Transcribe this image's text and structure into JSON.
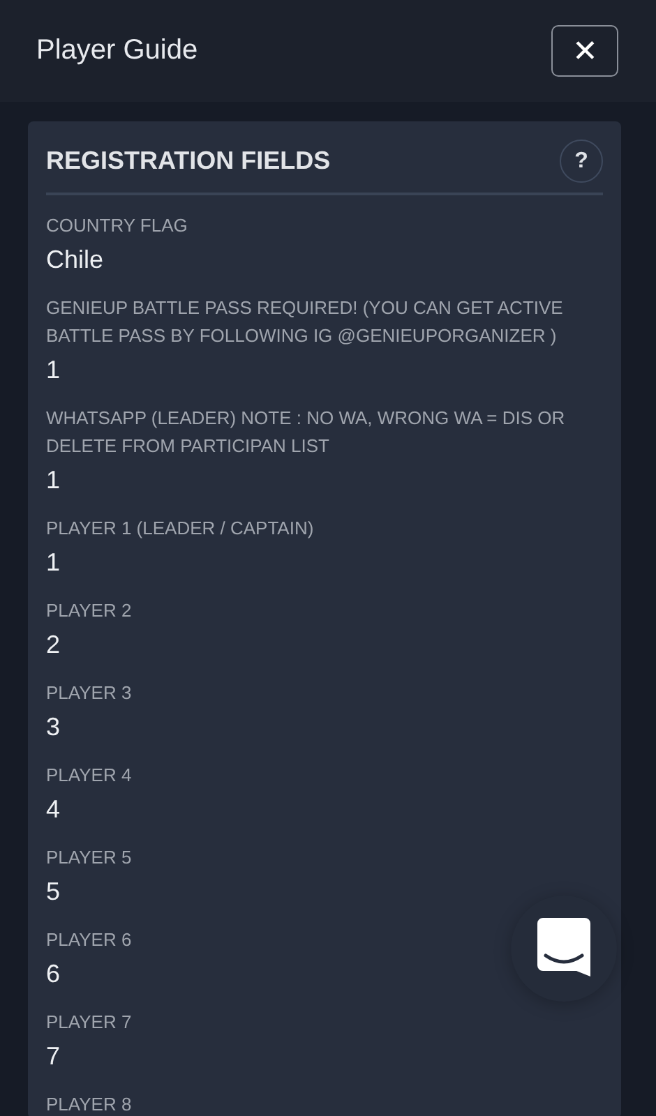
{
  "header": {
    "title": "Player Guide",
    "close": "✕"
  },
  "card": {
    "title": "REGISTRATION FIELDS",
    "help": "?",
    "fields": [
      {
        "label": "COUNTRY FLAG",
        "value": "Chile"
      },
      {
        "label": "GENIEUP BATTLE PASS REQUIRED! (YOU CAN GET ACTIVE BATTLE PASS BY FOLLOWING IG @GENIEUPORGANIZER )",
        "value": "1"
      },
      {
        "label": "WHATSAPP (LEADER) NOTE : NO WA, WRONG WA = DIS OR DELETE FROM PARTICIPAN LIST",
        "value": "1"
      },
      {
        "label": "PLAYER 1 (LEADER / CAPTAIN)",
        "value": "1"
      },
      {
        "label": "PLAYER 2",
        "value": "2"
      },
      {
        "label": "PLAYER 3",
        "value": "3"
      },
      {
        "label": "PLAYER 4",
        "value": "4"
      },
      {
        "label": "PLAYER 5",
        "value": "5"
      },
      {
        "label": "PLAYER 6",
        "value": "6"
      },
      {
        "label": "PLAYER 7",
        "value": "7"
      },
      {
        "label": "PLAYER 8"
      }
    ]
  }
}
